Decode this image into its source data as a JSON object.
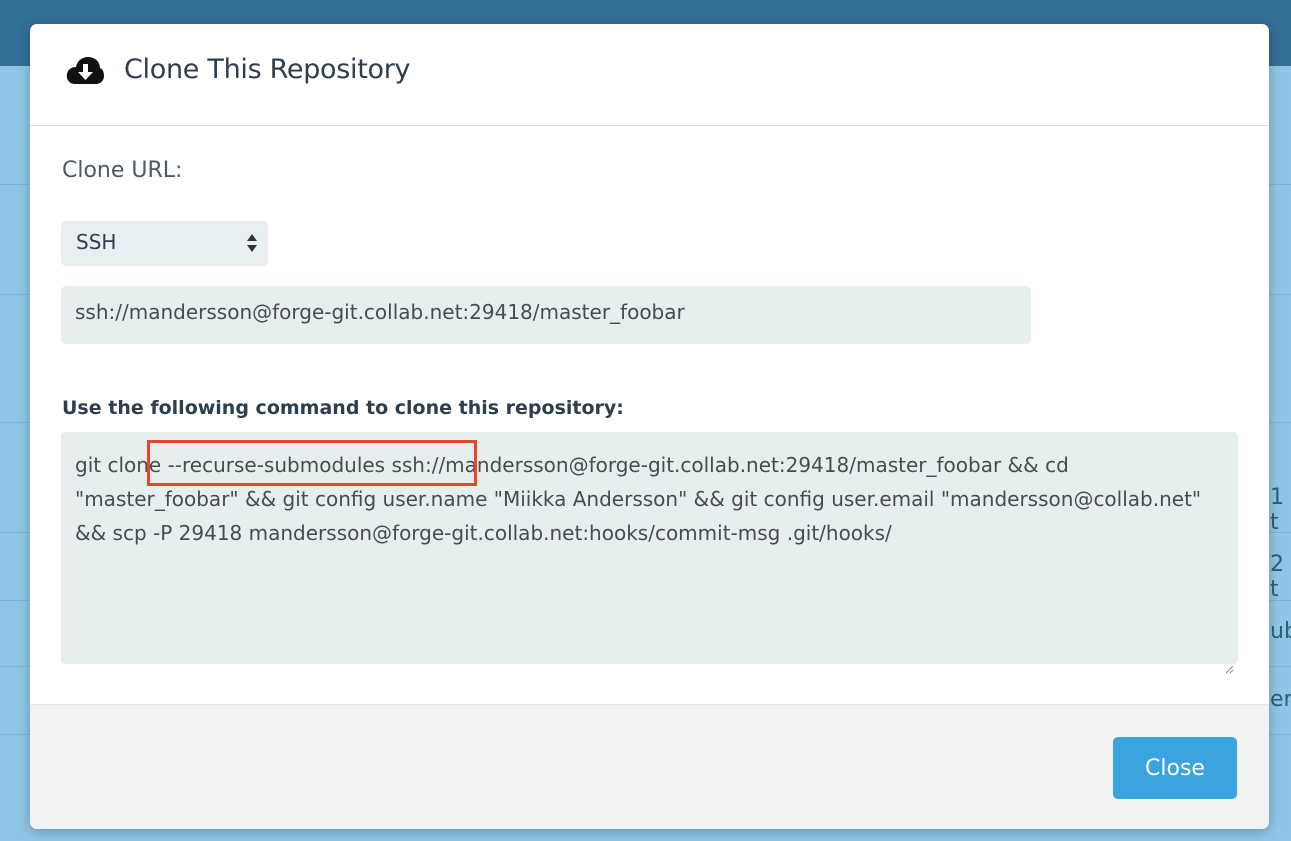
{
  "background": {
    "fragments": [
      "1 t",
      "2 t",
      "ub",
      "er"
    ]
  },
  "modal": {
    "title": "Clone This Repository",
    "title_icon": "cloud-download-icon",
    "clone_url_label": "Clone URL:",
    "protocol_select": {
      "selected": "SSH",
      "icon": "select-arrows-icon"
    },
    "clone_url": "ssh://mandersson@forge-git.collab.net:29418/master_foobar",
    "command_label": "Use the following command to clone this repository:",
    "command": "git clone --recurse-submodules ssh://mandersson@forge-git.collab.net:29418/master_foobar && cd \"master_foobar\" && git config user.name \"Miikka Andersson\" && git config user.email \"mandersson@collab.net\" && scp -P 29418 mandersson@forge-git.collab.net:hooks/commit-msg .git/hooks/",
    "close_label": "Close"
  },
  "colors": {
    "accent": "#3ba3dd",
    "highlight": "#e8452d",
    "topbar": "#336f96",
    "backdrop": "#8fc6e6"
  }
}
